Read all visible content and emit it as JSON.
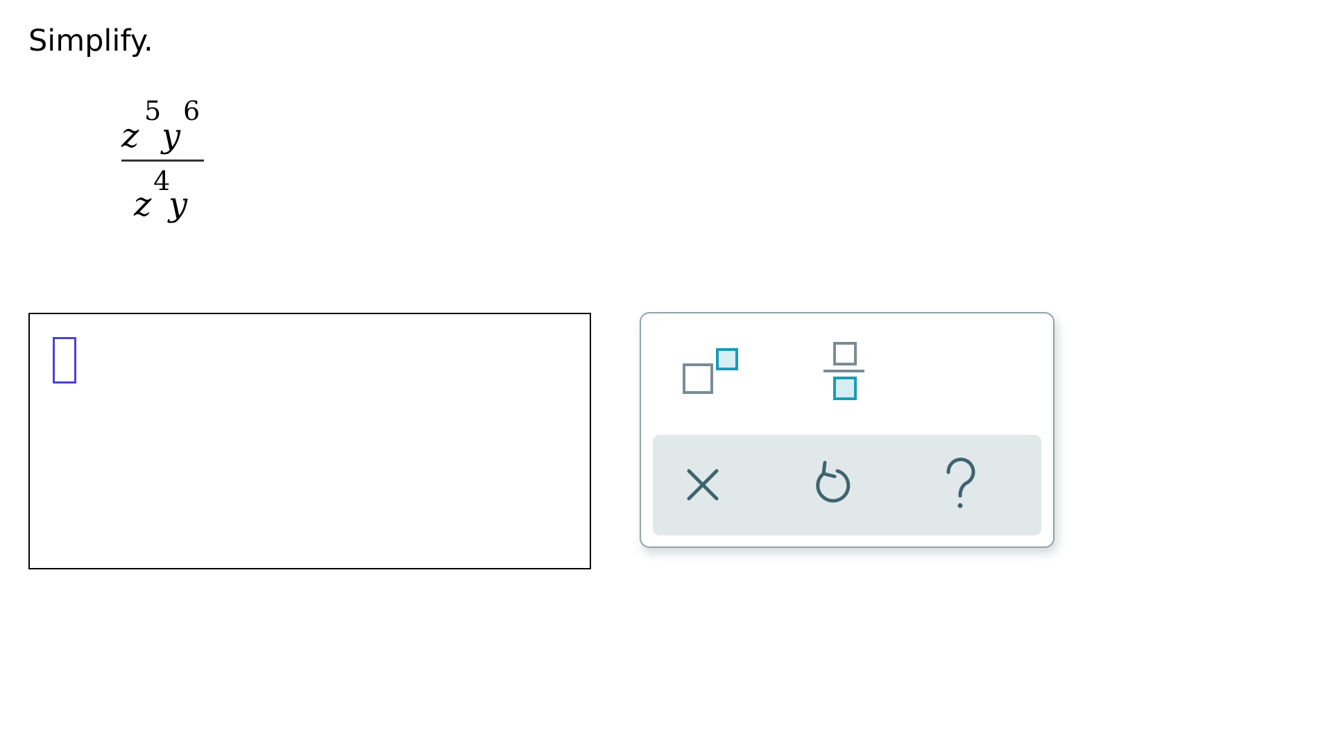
{
  "instruction": "Simplify.",
  "expression": {
    "numerator": {
      "term1": {
        "base": "z",
        "exponent": "5"
      },
      "term2": {
        "base": "y",
        "exponent": "6"
      }
    },
    "denominator": {
      "term1": {
        "base": "z",
        "exponent": "4"
      },
      "term2": {
        "base": "y"
      }
    }
  },
  "answer": {
    "value": ""
  },
  "keypad": {
    "keys": [
      {
        "name": "exponent",
        "icon": "superscript-template-icon"
      },
      {
        "name": "fraction",
        "icon": "fraction-template-icon"
      }
    ],
    "actions": [
      {
        "name": "clear",
        "icon": "close-icon"
      },
      {
        "name": "undo",
        "icon": "undo-icon"
      },
      {
        "name": "help",
        "icon": "question-icon"
      }
    ],
    "colors": {
      "accent": "#1a9bb3",
      "accent_fill": "#d4eef4",
      "icon_gray": "#7a8c93",
      "action_icon": "#3f6470",
      "action_bar": "#e1e8ea",
      "cursor": "#4b3fdb"
    }
  }
}
